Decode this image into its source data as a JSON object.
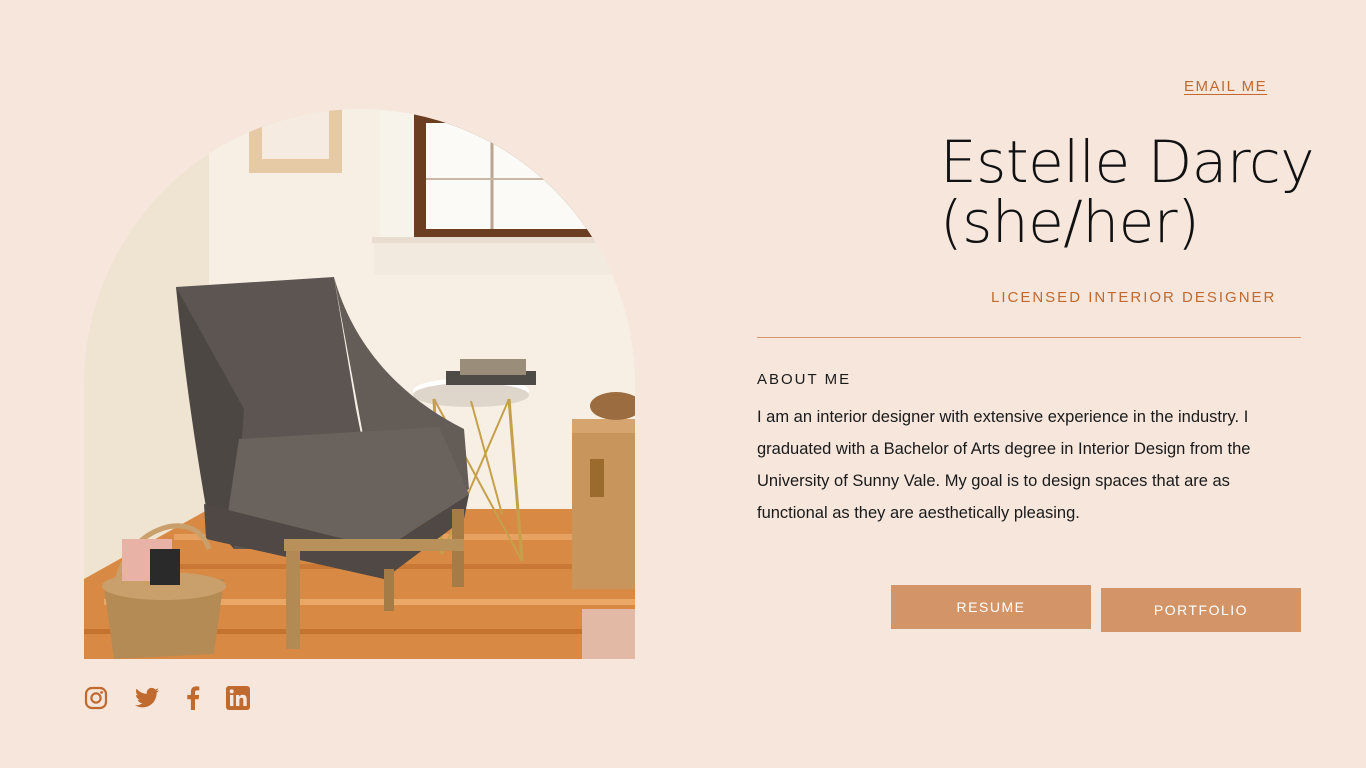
{
  "header": {
    "email_label": "EMAIL ME"
  },
  "profile": {
    "name_line1": "Estelle Darcy",
    "name_line2": "(she/her)",
    "title": "LICENSED INTERIOR DESIGNER"
  },
  "about": {
    "heading": "ABOUT ME",
    "body": "I am an interior designer with extensive experience in the industry. I graduated with a Bachelor of Arts degree in Interior Design from the University of Sunny Vale. My goal is to design spaces that are as functional as they are aesthetically pleasing."
  },
  "buttons": {
    "resume_label": "RESUME",
    "portfolio_label": "PORTFOLIO"
  },
  "social": {
    "icons": [
      "instagram-icon",
      "twitter-icon",
      "facebook-icon",
      "linkedin-icon"
    ]
  },
  "colors": {
    "background": "#f6e6dc",
    "accent": "#c06a2f",
    "button": "#d39467",
    "text": "#1a1a1a"
  }
}
